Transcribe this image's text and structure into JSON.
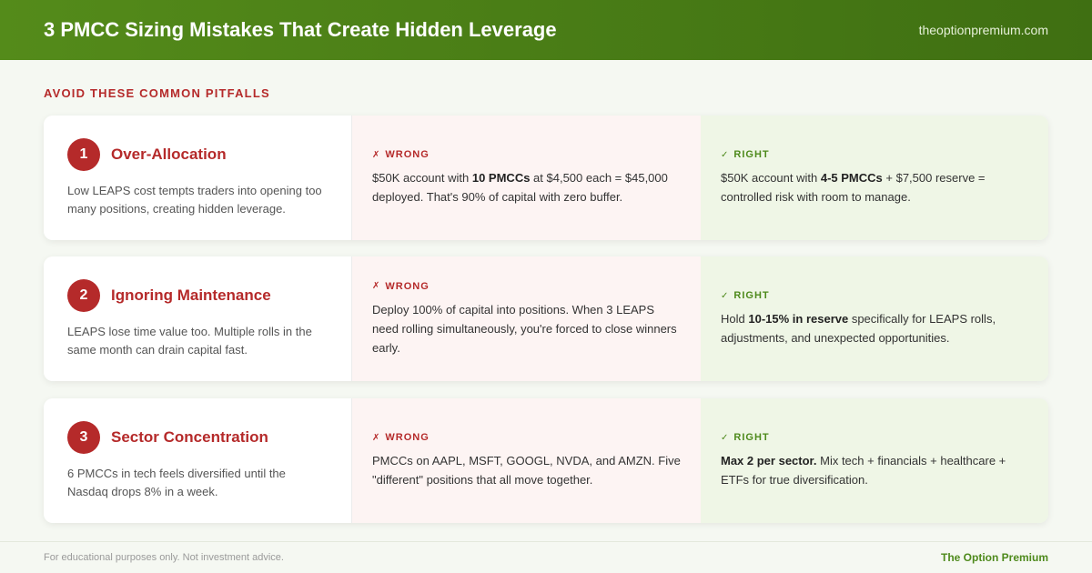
{
  "header": {
    "title": "3 PMCC Sizing Mistakes That Create Hidden Leverage",
    "site": "theoptionpremium.com"
  },
  "section_title": "AVOID THESE COMMON PITFALLS",
  "mistakes": [
    {
      "number": "1",
      "title": "Over-Allocation",
      "description": "Low LEAPS cost tempts traders into opening too many positions, creating hidden leverage.",
      "wrong_label": "WRONG",
      "wrong": [
        {
          "t": "$50K account with ",
          "b": false
        },
        {
          "t": "10 PMCCs",
          "b": true
        },
        {
          "t": " at $4,500 each = $45,000 deployed. That's 90% of capital with zero buffer.",
          "b": false
        }
      ],
      "right_label": "RIGHT",
      "right": [
        {
          "t": "$50K account with ",
          "b": false
        },
        {
          "t": "4-5 PMCCs",
          "b": true
        },
        {
          "t": " + $7,500 reserve = controlled risk with room to manage.",
          "b": false
        }
      ]
    },
    {
      "number": "2",
      "title": "Ignoring Maintenance",
      "description": "LEAPS lose time value too. Multiple rolls in the same month can drain capital fast.",
      "wrong_label": "WRONG",
      "wrong": [
        {
          "t": "Deploy 100% of capital into positions. When 3 LEAPS need rolling simultaneously, you're forced to close winners early.",
          "b": false
        }
      ],
      "right_label": "RIGHT",
      "right": [
        {
          "t": "Hold ",
          "b": false
        },
        {
          "t": "10-15% in reserve",
          "b": true
        },
        {
          "t": " specifically for LEAPS rolls, adjustments, and unexpected opportunities.",
          "b": false
        }
      ]
    },
    {
      "number": "3",
      "title": "Sector Concentration",
      "description": "6 PMCCs in tech feels diversified until the Nasdaq drops 8% in a week.",
      "wrong_label": "WRONG",
      "wrong": [
        {
          "t": "PMCCs on AAPL, MSFT, GOOGL, NVDA, and AMZN. Five \"different\" positions that all move together.",
          "b": false
        }
      ],
      "right_label": "RIGHT",
      "right": [
        {
          "t": "Max 2 per sector.",
          "b": true
        },
        {
          "t": " Mix tech + financials + healthcare + ETFs for true diversification.",
          "b": false
        }
      ]
    }
  ],
  "icons": {
    "wrong": "x-mark-icon",
    "right": "check-mark-icon"
  },
  "colors": {
    "brand_green": "#4e8a1c",
    "alert_red": "#b52a2a",
    "wrong_bg": "#fdf4f3",
    "right_bg": "#eff6e6"
  },
  "footer": {
    "disclaimer": "For educational purposes only. Not investment advice.",
    "brand": "The Option Premium"
  }
}
